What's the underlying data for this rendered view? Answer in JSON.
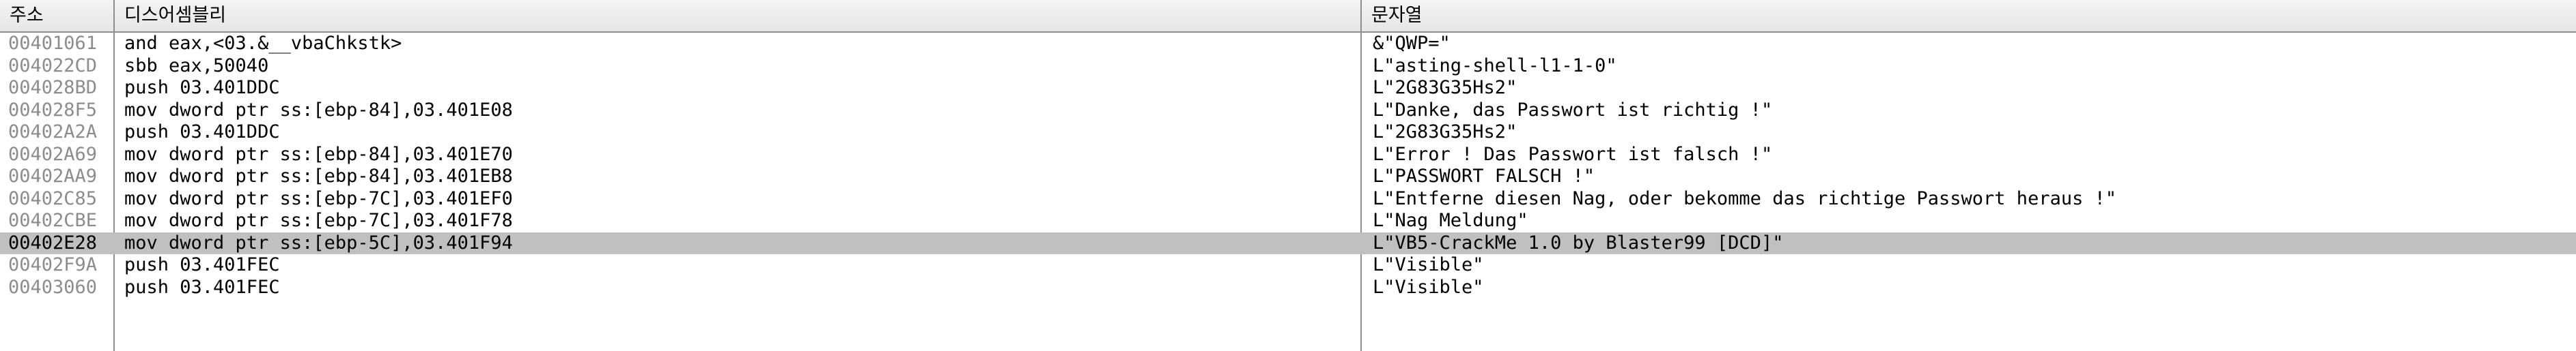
{
  "columns": {
    "address": "주소",
    "disassembly": "디스어셈블리",
    "string": "문자열"
  },
  "rows": [
    {
      "address": "00401061",
      "disassembly": "and eax,<03.&__vbaChkstk>",
      "string": "&\"QWP=\""
    },
    {
      "address": "004022CD",
      "disassembly": "sbb eax,50040",
      "string": "L\"asting-shell-l1-1-0\""
    },
    {
      "address": "004028BD",
      "disassembly": "push 03.401DDC",
      "string": "L\"2G83G35Hs2\""
    },
    {
      "address": "004028F5",
      "disassembly": "mov dword ptr ss:[ebp-84],03.401E08",
      "string": "L\"Danke, das Passwort ist richtig !\""
    },
    {
      "address": "00402A2A",
      "disassembly": "push 03.401DDC",
      "string": "L\"2G83G35Hs2\""
    },
    {
      "address": "00402A69",
      "disassembly": "mov dword ptr ss:[ebp-84],03.401E70",
      "string": "L\"Error ! Das Passwort ist falsch !\""
    },
    {
      "address": "00402AA9",
      "disassembly": "mov dword ptr ss:[ebp-84],03.401EB8",
      "string": "L\"PASSWORT FALSCH !\""
    },
    {
      "address": "00402C85",
      "disassembly": "mov dword ptr ss:[ebp-7C],03.401EF0",
      "string": "L\"Entferne diesen Nag, oder bekomme das richtige Passwort heraus !\""
    },
    {
      "address": "00402CBE",
      "disassembly": "mov dword ptr ss:[ebp-7C],03.401F78",
      "string": "L\"Nag Meldung\""
    },
    {
      "address": "00402E28",
      "disassembly": "mov dword ptr ss:[ebp-5C],03.401F94",
      "string": "L\"VB5-CrackMe 1.0 by Blaster99 [DCD]\""
    },
    {
      "address": "00402F9A",
      "disassembly": "push 03.401FEC",
      "string": "L\"Visible\""
    },
    {
      "address": "00403060",
      "disassembly": "push 03.401FEC",
      "string": "L\"Visible\""
    }
  ],
  "selected_row_address": "00402E28",
  "colors": {
    "selected_row_bg": "#c0c0c0",
    "address_text": "#8c8c8c",
    "grid_line": "#8e8e8e"
  }
}
